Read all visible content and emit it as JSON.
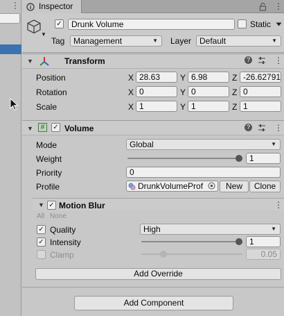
{
  "inspector": {
    "tab_title": "Inspector"
  },
  "object": {
    "name": "Drunk Volume",
    "active": true,
    "static_label": "Static",
    "static_checked": false,
    "tag_label": "Tag",
    "tag_value": "Management",
    "layer_label": "Layer",
    "layer_value": "Default"
  },
  "transform": {
    "title": "Transform",
    "rows": [
      {
        "label": "Position",
        "x": "28.63",
        "y": "6.98",
        "z": "-26.62791"
      },
      {
        "label": "Rotation",
        "x": "0",
        "y": "0",
        "z": "0"
      },
      {
        "label": "Scale",
        "x": "1",
        "y": "1",
        "z": "1"
      }
    ],
    "axis": {
      "x": "X",
      "y": "Y",
      "z": "Z"
    }
  },
  "volume": {
    "title": "Volume",
    "enabled": true,
    "hash_icon": "#",
    "mode_label": "Mode",
    "mode_value": "Global",
    "weight_label": "Weight",
    "weight_value": "1",
    "weight_level": 1,
    "priority_label": "Priority",
    "priority_value": "0",
    "profile_label": "Profile",
    "profile_value": "DrunkVolumeProf",
    "new_label": "New",
    "clone_label": "Clone"
  },
  "motion_blur": {
    "title": "Motion Blur",
    "enabled": true,
    "all_label": "All",
    "none_label": "None",
    "quality_label": "Quality",
    "quality_checked": true,
    "quality_value": "High",
    "intensity_label": "Intensity",
    "intensity_checked": true,
    "intensity_value": "1",
    "intensity_level": 1,
    "clamp_label": "Clamp",
    "clamp_checked": false,
    "clamp_value": "0.05",
    "clamp_level": 0.2
  },
  "buttons": {
    "add_override": "Add Override",
    "add_component": "Add Component"
  },
  "glyphs": {
    "check": "✓",
    "caret": "▼",
    "fold": "▼",
    "dots": "⋮",
    "help": "?"
  },
  "colors": {
    "background": "#c8c8c8",
    "field": "#f0f0f0",
    "selection": "#3a72b0"
  }
}
